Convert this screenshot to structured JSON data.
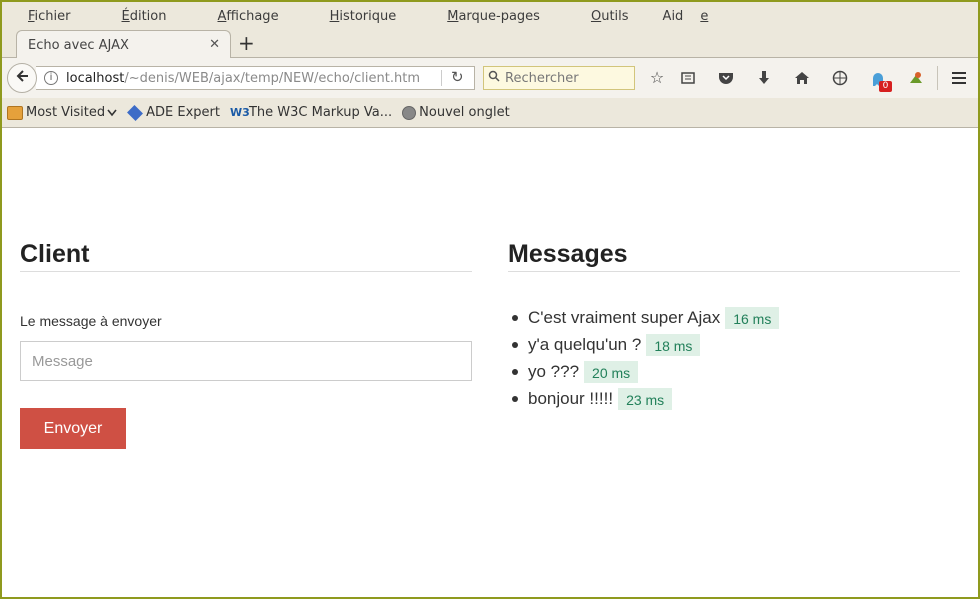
{
  "menu": {
    "items": [
      {
        "pre": "",
        "u": "F",
        "post": "ichier"
      },
      {
        "pre": "",
        "u": "É",
        "post": "dition"
      },
      {
        "pre": "",
        "u": "A",
        "post": "ffichage"
      },
      {
        "pre": "",
        "u": "H",
        "post": "istorique"
      },
      {
        "pre": "",
        "u": "M",
        "post": "arque-pages"
      },
      {
        "pre": "",
        "u": "O",
        "post": "utils"
      },
      {
        "pre": "Aid",
        "u": "e",
        "post": ""
      }
    ]
  },
  "tab": {
    "title": "Echo avec AJAX",
    "close_glyph": "✕",
    "new_tab_glyph": "+"
  },
  "navbar": {
    "url_host": "localhost",
    "url_path": "/~denis/WEB/ajax/temp/NEW/echo/client.htm",
    "search_placeholder": "Rechercher",
    "notification_count": "0"
  },
  "bookmarks": [
    {
      "label": "Most Visited",
      "icon": "folder-icon",
      "has_chevron": true
    },
    {
      "label": "ADE Expert",
      "icon": "ade-icon"
    },
    {
      "label": "The W3C Markup Va...",
      "icon": "w3c-icon"
    },
    {
      "label": "Nouvel onglet",
      "icon": "globe-icon"
    }
  ],
  "client": {
    "title": "Client",
    "label": "Le message à envoyer",
    "input_placeholder": "Message",
    "input_value": "",
    "send_label": "Envoyer"
  },
  "messages": {
    "title": "Messages",
    "items": [
      {
        "text": "C'est vraiment super Ajax",
        "time": "16 ms"
      },
      {
        "text": "y'a quelqu'un ?",
        "time": "18 ms"
      },
      {
        "text": "yo ???",
        "time": "20 ms"
      },
      {
        "text": "bonjour !!!!!",
        "time": "23 ms"
      }
    ]
  },
  "colors": {
    "window_border": "#8f9a1e",
    "chrome_bg": "#ece8dc",
    "send_button": "#cf5044",
    "time_badge_bg": "#dff0e6",
    "time_badge_text": "#22805a"
  }
}
